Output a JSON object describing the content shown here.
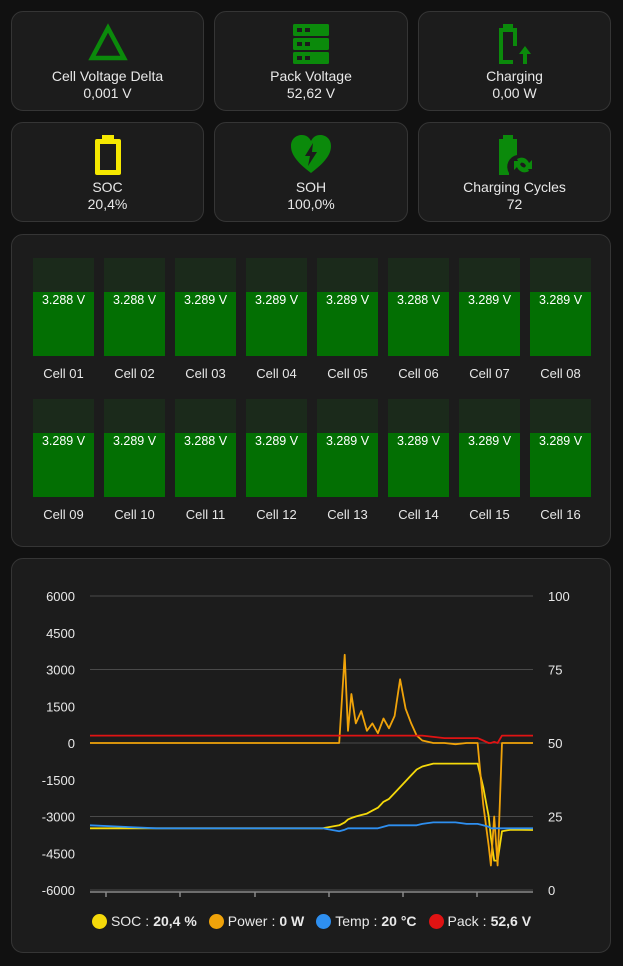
{
  "tiles": [
    {
      "name": "Cell Voltage Delta",
      "value": "0,001 V",
      "icon": "triangle-outline-icon",
      "color": "#0b8a0b"
    },
    {
      "name": "Pack Voltage",
      "value": "52,62 V",
      "icon": "server-stack-icon",
      "color": "#0b8a0b"
    },
    {
      "name": "Charging",
      "value": "0,00 W",
      "icon": "battery-charging-arrow-icon",
      "color": "#0b8a0b"
    },
    {
      "name": "SOC",
      "value": "20,4%",
      "icon": "battery-low-icon",
      "color": "#f5e800"
    },
    {
      "name": "SOH",
      "value": "100,0%",
      "icon": "heart-flash-icon",
      "color": "#0b8a0b"
    },
    {
      "name": "Charging Cycles",
      "value": "72",
      "icon": "battery-sync-icon",
      "color": "#0b8a0b"
    }
  ],
  "cells": [
    {
      "label": "Cell 01",
      "value": "3.288 V"
    },
    {
      "label": "Cell 02",
      "value": "3.288 V"
    },
    {
      "label": "Cell 03",
      "value": "3.289 V"
    },
    {
      "label": "Cell 04",
      "value": "3.289 V"
    },
    {
      "label": "Cell 05",
      "value": "3.289 V"
    },
    {
      "label": "Cell 06",
      "value": "3.288 V"
    },
    {
      "label": "Cell 07",
      "value": "3.289 V"
    },
    {
      "label": "Cell 08",
      "value": "3.289 V"
    },
    {
      "label": "Cell 09",
      "value": "3.289 V"
    },
    {
      "label": "Cell 10",
      "value": "3.289 V"
    },
    {
      "label": "Cell 11",
      "value": "3.288 V"
    },
    {
      "label": "Cell 12",
      "value": "3.289 V"
    },
    {
      "label": "Cell 13",
      "value": "3.289 V"
    },
    {
      "label": "Cell 14",
      "value": "3.289 V"
    },
    {
      "label": "Cell 15",
      "value": "3.289 V"
    },
    {
      "label": "Cell 16",
      "value": "3.289 V"
    }
  ],
  "cell_fill_fraction": 0.65,
  "chart_data": {
    "type": "line",
    "y_left_ticks": [
      "6000",
      "4500",
      "3000",
      "1500",
      "0",
      "-1500",
      "-3000",
      "-4500",
      "-6000"
    ],
    "y_right_ticks": [
      "100",
      "75",
      "50",
      "25",
      "0"
    ],
    "ylim_left": [
      -6000,
      6000
    ],
    "ylim_right": [
      0,
      100
    ],
    "x": [
      0,
      60,
      100,
      150,
      180,
      210,
      225,
      230,
      233,
      236,
      240,
      245,
      250,
      255,
      260,
      265,
      270,
      275,
      280,
      285,
      290,
      295,
      300,
      310,
      320,
      330,
      340,
      350,
      355,
      360,
      362,
      365,
      368,
      372,
      380,
      400
    ],
    "series": [
      {
        "name": "SOC",
        "axis": "right",
        "color": "#f5d90a",
        "values": [
          21,
          21,
          21,
          21,
          21,
          21,
          22,
          23,
          24,
          24.5,
          25,
          25.5,
          26,
          27,
          28,
          30,
          31,
          33,
          35,
          37,
          39,
          41,
          42,
          43,
          43,
          43,
          43,
          43,
          35,
          25,
          18,
          10,
          10,
          20,
          20.5,
          20.4
        ]
      },
      {
        "name": "Power",
        "axis": "left",
        "color": "#f0a30a",
        "values": [
          0,
          0,
          0,
          0,
          0,
          0,
          0,
          3600,
          500,
          2000,
          800,
          1300,
          500,
          800,
          400,
          1000,
          600,
          1100,
          2600,
          1400,
          800,
          300,
          100,
          0,
          0,
          -50,
          0,
          0,
          -2500,
          -4200,
          -5000,
          -3000,
          -5000,
          0,
          0,
          0
        ]
      },
      {
        "name": "Temp",
        "axis": "right",
        "color": "#2e8ff0",
        "values": [
          22,
          21,
          21,
          21,
          21,
          21,
          20,
          20.5,
          21,
          21,
          21,
          21,
          21,
          21,
          21,
          21.5,
          22,
          22,
          22,
          22,
          22,
          22,
          22.5,
          23,
          23,
          23,
          22.5,
          22.5,
          22,
          21.5,
          21,
          21,
          21,
          21,
          21,
          21
        ]
      },
      {
        "name": "Pack",
        "axis": "left",
        "color": "#e01313",
        "values": [
          300,
          300,
          300,
          300,
          300,
          300,
          300,
          300,
          300,
          300,
          300,
          300,
          300,
          300,
          300,
          300,
          300,
          300,
          300,
          300,
          300,
          300,
          300,
          250,
          200,
          200,
          200,
          200,
          100,
          0,
          0,
          50,
          0,
          300,
          300,
          300
        ]
      }
    ],
    "legend": [
      {
        "name": "SOC",
        "value": "20,4 %",
        "color": "#f5d90a"
      },
      {
        "name": "Power",
        "value": "0 W",
        "color": "#f0a30a"
      },
      {
        "name": "Temp",
        "value": "20 °C",
        "color": "#2e8ff0"
      },
      {
        "name": "Pack",
        "value": "52,6 V",
        "color": "#e01313"
      }
    ],
    "legend_position": "bottom",
    "grid": true
  }
}
